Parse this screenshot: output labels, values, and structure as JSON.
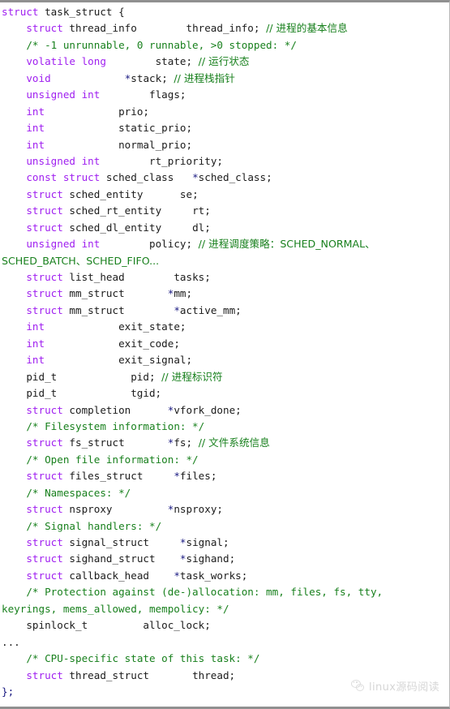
{
  "document": {
    "kind": "source-code-listing",
    "language": "c",
    "struct_name": "task_struct",
    "colors": {
      "background": "#ffffff",
      "keyword": "#a020f0",
      "identifier": "#1b1b1b",
      "comment": "#18801d",
      "pointer": "#181880",
      "border": "#909090"
    }
  },
  "watermark": {
    "text": "linux源码阅读",
    "logo_icon": "wechat-logo-icon"
  },
  "code": {
    "lines": [
      {
        "tokens": [
          {
            "t": "struct ",
            "c": "kw"
          },
          {
            "t": "task_struct {",
            "c": "id"
          }
        ]
      },
      {
        "tokens": [
          {
            "t": "    ",
            "c": "plain"
          },
          {
            "t": "struct ",
            "c": "kw"
          },
          {
            "t": "thread_info        thread_info; ",
            "c": "id"
          },
          {
            "t": "// 进程的基本信息",
            "c": "cmt"
          }
        ]
      },
      {
        "tokens": [
          {
            "t": "    ",
            "c": "plain"
          },
          {
            "t": "/* -1 unrunnable, 0 runnable, >0 stopped: */",
            "c": "cmt"
          }
        ]
      },
      {
        "tokens": [
          {
            "t": "    ",
            "c": "plain"
          },
          {
            "t": "volatile long",
            "c": "kw"
          },
          {
            "t": "        state; ",
            "c": "id"
          },
          {
            "t": "// 运行状态",
            "c": "cmt"
          }
        ]
      },
      {
        "tokens": [
          {
            "t": "    ",
            "c": "plain"
          },
          {
            "t": "void",
            "c": "kw"
          },
          {
            "t": "            ",
            "c": "plain"
          },
          {
            "t": "*",
            "c": "ptr"
          },
          {
            "t": "stack; ",
            "c": "id"
          },
          {
            "t": "// 进程栈指针",
            "c": "cmt"
          }
        ]
      },
      {
        "tokens": [
          {
            "t": "    ",
            "c": "plain"
          },
          {
            "t": "unsigned int",
            "c": "kw"
          },
          {
            "t": "        flags;",
            "c": "id"
          }
        ]
      },
      {
        "tokens": [
          {
            "t": "    ",
            "c": "plain"
          },
          {
            "t": "int",
            "c": "kw"
          },
          {
            "t": "            prio;",
            "c": "id"
          }
        ]
      },
      {
        "tokens": [
          {
            "t": "    ",
            "c": "plain"
          },
          {
            "t": "int",
            "c": "kw"
          },
          {
            "t": "            static_prio;",
            "c": "id"
          }
        ]
      },
      {
        "tokens": [
          {
            "t": "    ",
            "c": "plain"
          },
          {
            "t": "int",
            "c": "kw"
          },
          {
            "t": "            normal_prio;",
            "c": "id"
          }
        ]
      },
      {
        "tokens": [
          {
            "t": "    ",
            "c": "plain"
          },
          {
            "t": "unsigned int",
            "c": "kw"
          },
          {
            "t": "        rt_priority;",
            "c": "id"
          }
        ]
      },
      {
        "tokens": [
          {
            "t": "    ",
            "c": "plain"
          },
          {
            "t": "const struct ",
            "c": "kw"
          },
          {
            "t": "sched_class   ",
            "c": "id"
          },
          {
            "t": "*",
            "c": "ptr"
          },
          {
            "t": "sched_class;",
            "c": "id"
          }
        ]
      },
      {
        "tokens": [
          {
            "t": "    ",
            "c": "plain"
          },
          {
            "t": "struct ",
            "c": "kw"
          },
          {
            "t": "sched_entity      se;",
            "c": "id"
          }
        ]
      },
      {
        "tokens": [
          {
            "t": "    ",
            "c": "plain"
          },
          {
            "t": "struct ",
            "c": "kw"
          },
          {
            "t": "sched_rt_entity     rt;",
            "c": "id"
          }
        ]
      },
      {
        "tokens": [
          {
            "t": "    ",
            "c": "plain"
          },
          {
            "t": "struct ",
            "c": "kw"
          },
          {
            "t": "sched_dl_entity     dl;",
            "c": "id"
          }
        ]
      },
      {
        "tokens": [
          {
            "t": "    ",
            "c": "plain"
          },
          {
            "t": "unsigned int",
            "c": "kw"
          },
          {
            "t": "        policy; ",
            "c": "id"
          },
          {
            "t": "// 进程调度策略：SCHED_NORMAL、",
            "c": "cmt"
          }
        ]
      },
      {
        "tokens": [
          {
            "t": "SCHED_BATCH、SCHED_FIFO...",
            "c": "cmt"
          }
        ]
      },
      {
        "tokens": [
          {
            "t": "    ",
            "c": "plain"
          },
          {
            "t": "struct ",
            "c": "kw"
          },
          {
            "t": "list_head        tasks;",
            "c": "id"
          }
        ]
      },
      {
        "tokens": [
          {
            "t": "    ",
            "c": "plain"
          },
          {
            "t": "struct ",
            "c": "kw"
          },
          {
            "t": "mm_struct       ",
            "c": "id"
          },
          {
            "t": "*",
            "c": "ptr"
          },
          {
            "t": "mm;",
            "c": "id"
          }
        ]
      },
      {
        "tokens": [
          {
            "t": "    ",
            "c": "plain"
          },
          {
            "t": "struct ",
            "c": "kw"
          },
          {
            "t": "mm_struct        ",
            "c": "id"
          },
          {
            "t": "*",
            "c": "ptr"
          },
          {
            "t": "active_mm;",
            "c": "id"
          }
        ]
      },
      {
        "tokens": [
          {
            "t": "    ",
            "c": "plain"
          },
          {
            "t": "int",
            "c": "kw"
          },
          {
            "t": "            exit_state;",
            "c": "id"
          }
        ]
      },
      {
        "tokens": [
          {
            "t": "    ",
            "c": "plain"
          },
          {
            "t": "int",
            "c": "kw"
          },
          {
            "t": "            exit_code;",
            "c": "id"
          }
        ]
      },
      {
        "tokens": [
          {
            "t": "    ",
            "c": "plain"
          },
          {
            "t": "int",
            "c": "kw"
          },
          {
            "t": "            exit_signal;",
            "c": "id"
          }
        ]
      },
      {
        "tokens": [
          {
            "t": "    pid_t            pid; ",
            "c": "id"
          },
          {
            "t": "// 进程标识符",
            "c": "cmt"
          }
        ]
      },
      {
        "tokens": [
          {
            "t": "    pid_t            tgid;",
            "c": "id"
          }
        ]
      },
      {
        "tokens": [
          {
            "t": "    ",
            "c": "plain"
          },
          {
            "t": "struct ",
            "c": "kw"
          },
          {
            "t": "completion      ",
            "c": "id"
          },
          {
            "t": "*",
            "c": "ptr"
          },
          {
            "t": "vfork_done;",
            "c": "id"
          }
        ]
      },
      {
        "tokens": [
          {
            "t": "    ",
            "c": "plain"
          },
          {
            "t": "/* Filesystem information: */",
            "c": "cmt"
          }
        ]
      },
      {
        "tokens": [
          {
            "t": "    ",
            "c": "plain"
          },
          {
            "t": "struct ",
            "c": "kw"
          },
          {
            "t": "fs_struct       ",
            "c": "id"
          },
          {
            "t": "*",
            "c": "ptr"
          },
          {
            "t": "fs; ",
            "c": "id"
          },
          {
            "t": "// 文件系统信息",
            "c": "cmt"
          }
        ]
      },
      {
        "tokens": [
          {
            "t": "    ",
            "c": "plain"
          },
          {
            "t": "/* Open file information: */",
            "c": "cmt"
          }
        ]
      },
      {
        "tokens": [
          {
            "t": "    ",
            "c": "plain"
          },
          {
            "t": "struct ",
            "c": "kw"
          },
          {
            "t": "files_struct     ",
            "c": "id"
          },
          {
            "t": "*",
            "c": "ptr"
          },
          {
            "t": "files;",
            "c": "id"
          }
        ]
      },
      {
        "tokens": [
          {
            "t": "    ",
            "c": "plain"
          },
          {
            "t": "/* Namespaces: */",
            "c": "cmt"
          }
        ]
      },
      {
        "tokens": [
          {
            "t": "    ",
            "c": "plain"
          },
          {
            "t": "struct ",
            "c": "kw"
          },
          {
            "t": "nsproxy         ",
            "c": "id"
          },
          {
            "t": "*",
            "c": "ptr"
          },
          {
            "t": "nsproxy;",
            "c": "id"
          }
        ]
      },
      {
        "tokens": [
          {
            "t": "    ",
            "c": "plain"
          },
          {
            "t": "/* Signal handlers: */",
            "c": "cmt"
          }
        ]
      },
      {
        "tokens": [
          {
            "t": "    ",
            "c": "plain"
          },
          {
            "t": "struct ",
            "c": "kw"
          },
          {
            "t": "signal_struct     ",
            "c": "id"
          },
          {
            "t": "*",
            "c": "ptr"
          },
          {
            "t": "signal;",
            "c": "id"
          }
        ]
      },
      {
        "tokens": [
          {
            "t": "    ",
            "c": "plain"
          },
          {
            "t": "struct ",
            "c": "kw"
          },
          {
            "t": "sighand_struct    ",
            "c": "id"
          },
          {
            "t": "*",
            "c": "ptr"
          },
          {
            "t": "sighand;",
            "c": "id"
          }
        ]
      },
      {
        "tokens": [
          {
            "t": "    ",
            "c": "plain"
          },
          {
            "t": "struct ",
            "c": "kw"
          },
          {
            "t": "callback_head    ",
            "c": "id"
          },
          {
            "t": "*",
            "c": "ptr"
          },
          {
            "t": "task_works;",
            "c": "id"
          }
        ]
      },
      {
        "tokens": [
          {
            "t": "    ",
            "c": "plain"
          },
          {
            "t": "/* Protection against (de-)allocation: mm, files, fs, tty,",
            "c": "cmt"
          }
        ]
      },
      {
        "tokens": [
          {
            "t": "keyrings, mems_allowed, mempolicy: */",
            "c": "cmt"
          }
        ]
      },
      {
        "tokens": [
          {
            "t": "    spinlock_t         alloc_lock;",
            "c": "id"
          }
        ]
      },
      {
        "tokens": [
          {
            "t": "...",
            "c": "id"
          }
        ]
      },
      {
        "tokens": [
          {
            "t": "    ",
            "c": "plain"
          },
          {
            "t": "/* CPU-specific state of this task: */",
            "c": "cmt"
          }
        ]
      },
      {
        "tokens": [
          {
            "t": "    ",
            "c": "plain"
          },
          {
            "t": "struct ",
            "c": "kw"
          },
          {
            "t": "thread_struct       thread;",
            "c": "id"
          }
        ]
      },
      {
        "tokens": [
          {
            "t": "};",
            "c": "pun"
          }
        ]
      }
    ]
  }
}
